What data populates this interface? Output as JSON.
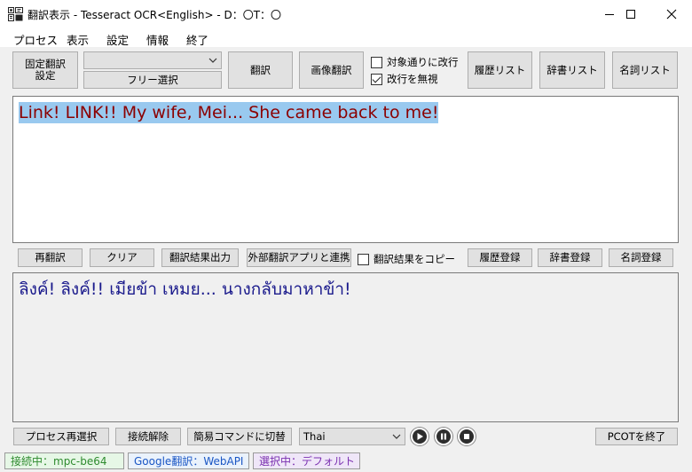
{
  "window": {
    "title": "翻訳表示 - Tesseract OCR<English> - D：〇T：〇",
    "minimize_glyph": "—",
    "close_glyph": "✕"
  },
  "menu": {
    "items": [
      "プロセス",
      "表示",
      "設定",
      "情報",
      "終了"
    ]
  },
  "toolbar": {
    "fixed_setting_label": "固定翻訳\n設定",
    "combo_value": "",
    "free_select_label": "フリー選択",
    "translate_label": "翻訳",
    "image_translate_label": "画像翻訳",
    "wrap_check_label": "対象通りに改行",
    "wrap_checked": false,
    "ignore_newline_label": "改行を無視",
    "ignore_newline_checked": true,
    "history_list_label": "履歴リスト",
    "dict_list_label": "辞書リスト",
    "noun_list_label": "名詞リスト"
  },
  "source": {
    "text": "Link! LINK!! My wife, Mei... She came back to me!",
    "text_color": "#8b0000",
    "highlight_color": "#99c9ef"
  },
  "actions": {
    "retranslate_label": "再翻訳",
    "clear_label": "クリア",
    "output_label": "翻訳結果出力",
    "external_label": "外部翻訳アプリと連携",
    "copy_check_label": "翻訳結果をコピー",
    "copy_checked": false,
    "history_register_label": "履歴登録",
    "dict_register_label": "辞書登録",
    "noun_register_label": "名詞登録"
  },
  "translation": {
    "text": "ลิงค์! ลิงค์!! เมียข้า เหมย... นางกลับมาหาข้า!",
    "text_color": "#1a1a8c"
  },
  "bottom": {
    "reselect_label": "プロセス再選択",
    "disconnect_label": "接続解除",
    "simple_cmd_label": "簡易コマンドに切替",
    "language_value": "Thai",
    "exit_label": "PCOTを終了"
  },
  "status": {
    "connection": "接続中：mpc-be64",
    "engine": "Google翻訳：WebAPI",
    "selection": "選択中：デフォルト",
    "connection_color": "#e6f7e6",
    "engine_color": "#eaf2fc",
    "selection_color": "#efe6f8"
  },
  "icons": {
    "app": "app-logo-icon",
    "minimize": "minimize-icon",
    "maximize": "maximize-icon",
    "close": "close-icon",
    "play": "play-icon",
    "pause": "pause-icon",
    "stop": "stop-icon"
  }
}
